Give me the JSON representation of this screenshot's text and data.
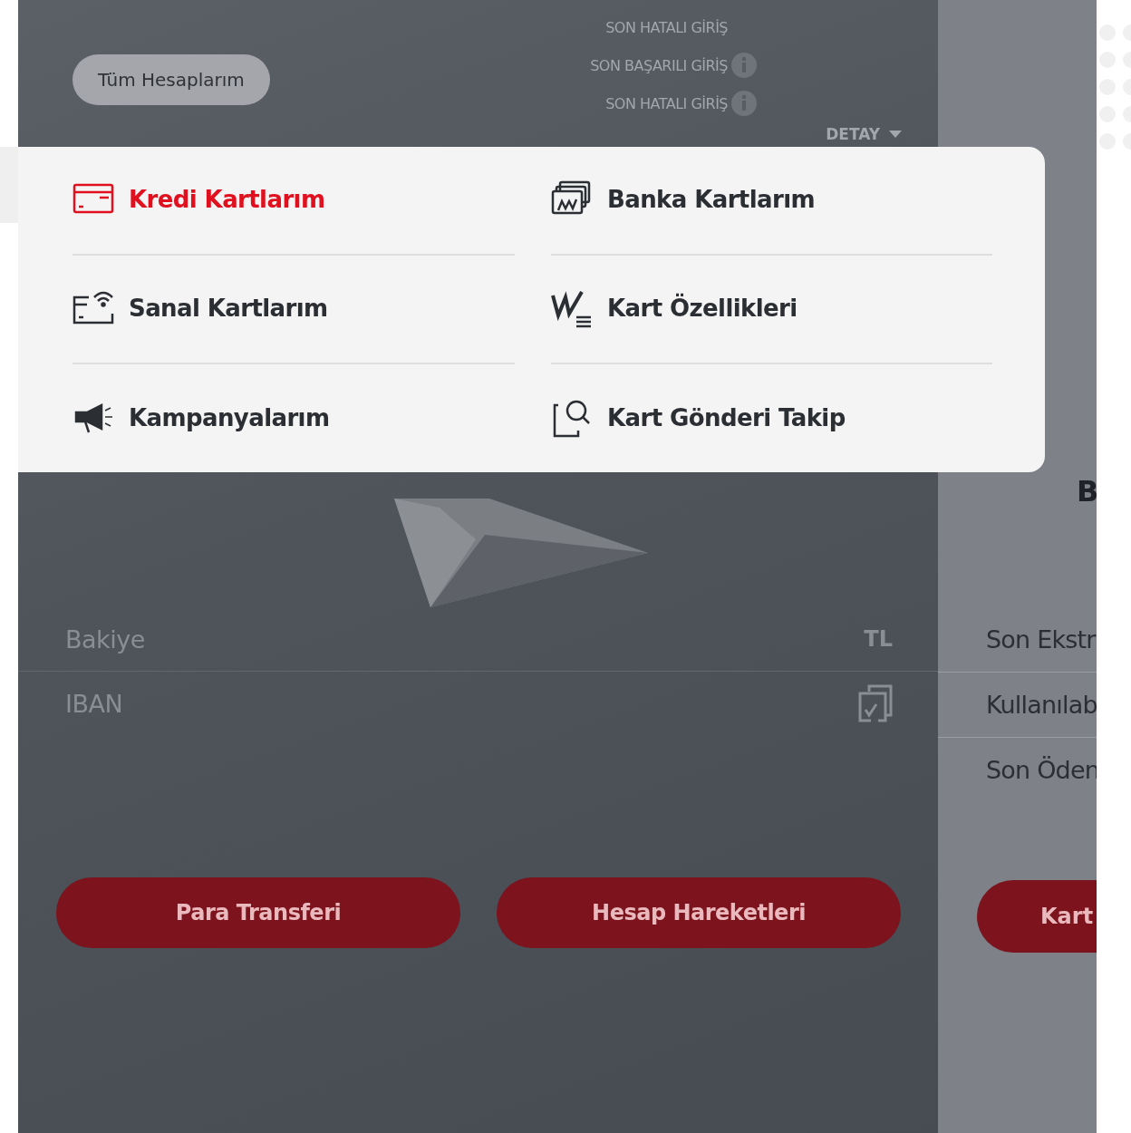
{
  "account_button": "Tüm Hesaplarım",
  "login_info": [
    {
      "label": "SON HATALI GİRİŞ",
      "info": false
    },
    {
      "label": "SON BAŞARILI GİRİŞ",
      "info": true
    },
    {
      "label": "SON HATALI GİRİŞ",
      "info": true
    }
  ],
  "detail_toggle": {
    "label": "DETAY",
    "expanded": false
  },
  "menu": [
    {
      "label": "Kredi Kartlarım",
      "kind": "credit-card",
      "selected": true
    },
    {
      "label": "Banka Kartlarım",
      "kind": "bank-cards",
      "selected": false
    },
    {
      "label": "Sanal Kartlarım",
      "kind": "virtual-card",
      "selected": false
    },
    {
      "label": "Kart Özellikleri",
      "kind": "features",
      "selected": false
    },
    {
      "label": "Kampanyalarım",
      "kind": "megaphone",
      "selected": false
    },
    {
      "label": "Kart Gönderi Takip",
      "kind": "tracking",
      "selected": false
    }
  ],
  "account_rows": [
    {
      "label": "Bakiye",
      "kind": "currency",
      "suffix": "TL"
    },
    {
      "label": "IBAN",
      "kind": "copy"
    }
  ],
  "actions": [
    "Para Transferi",
    "Hesap Hareketleri"
  ],
  "side_panel": {
    "heading": "B",
    "rows": [
      "Son Ekstr",
      "Kullanılab",
      "Son Öden"
    ],
    "button": "Kart"
  }
}
